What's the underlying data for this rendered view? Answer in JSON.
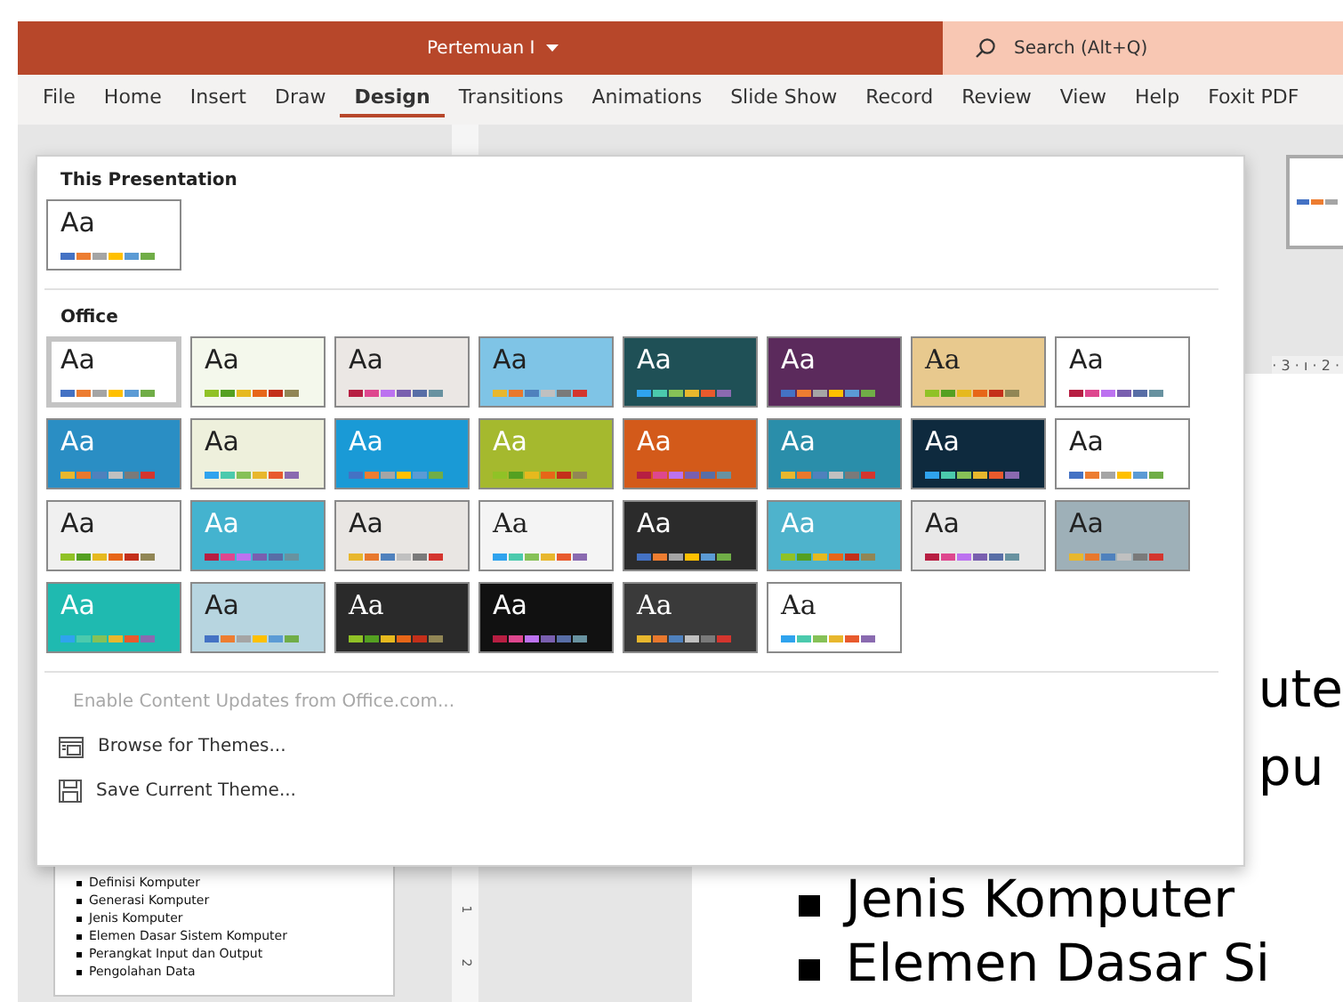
{
  "window": {
    "title": "Pertemuan I"
  },
  "search": {
    "placeholder": "Search (Alt+Q)"
  },
  "tabs": [
    {
      "label": "File",
      "selected": false
    },
    {
      "label": "Home",
      "selected": false
    },
    {
      "label": "Insert",
      "selected": false
    },
    {
      "label": "Draw",
      "selected": false
    },
    {
      "label": "Design",
      "selected": true
    },
    {
      "label": "Transitions",
      "selected": false
    },
    {
      "label": "Animations",
      "selected": false
    },
    {
      "label": "Slide Show",
      "selected": false
    },
    {
      "label": "Record",
      "selected": false
    },
    {
      "label": "Review",
      "selected": false
    },
    {
      "label": "View",
      "selected": false
    },
    {
      "label": "Help",
      "selected": false
    },
    {
      "label": "Foxit PDF",
      "selected": false
    }
  ],
  "ruler": {
    "horizontal": "· 3 · ı · 2 ·",
    "vertical": [
      "1",
      "2"
    ]
  },
  "themes_menu": {
    "sections": [
      {
        "title": "This Presentation",
        "themes": [
          {
            "label": "Aa",
            "kind": "sans",
            "selected": false,
            "color": "#ffffff"
          }
        ]
      },
      {
        "title": "Office",
        "themes": [
          {
            "label": "Aa",
            "kind": "sans",
            "selected": true,
            "color": "#ffffff"
          },
          {
            "label": "Aa",
            "kind": "sans",
            "selected": false,
            "color": "#f4f8ec"
          },
          {
            "label": "Aa",
            "kind": "sans",
            "selected": false,
            "color": "#ebe7e4"
          },
          {
            "label": "Aa",
            "kind": "sans",
            "selected": false,
            "color": "#7fc4e6"
          },
          {
            "label": "Aa",
            "kind": "sans",
            "selected": false,
            "color": "#1f5056"
          },
          {
            "label": "Aa",
            "kind": "sans",
            "selected": false,
            "color": "#5b2a5c"
          },
          {
            "label": "Aa",
            "kind": "serif",
            "selected": false,
            "color": "#e8c98e"
          },
          {
            "label": "Aa",
            "kind": "sans",
            "selected": false,
            "color": "#ffffff"
          },
          {
            "label": "Aa",
            "kind": "sans",
            "selected": false,
            "color": "#2a8ec4"
          },
          {
            "label": "Aa",
            "kind": "sans",
            "selected": false,
            "color": "#eef0dc"
          },
          {
            "label": "Aa",
            "kind": "sans",
            "selected": false,
            "color": "#1a9ad6"
          },
          {
            "label": "Aa",
            "kind": "sans",
            "selected": false,
            "color": "#a5b92e"
          },
          {
            "label": "Aa",
            "kind": "sans",
            "selected": false,
            "color": "#d35a1a"
          },
          {
            "label": "Aa",
            "kind": "sans",
            "selected": false,
            "color": "#2a8eaa"
          },
          {
            "label": "Aa",
            "kind": "sans",
            "selected": false,
            "color": "#0e2a3e"
          },
          {
            "label": "Aa",
            "kind": "sans",
            "selected": false,
            "color": "#ffffff"
          },
          {
            "label": "Aa",
            "kind": "sans",
            "selected": false,
            "color": "#f0f0f0"
          },
          {
            "label": "Aa",
            "kind": "sans",
            "selected": false,
            "color": "#44b3cf"
          },
          {
            "label": "Aa",
            "kind": "sans",
            "selected": false,
            "color": "#e9e6e3"
          },
          {
            "label": "Aa",
            "kind": "serif",
            "selected": false,
            "color": "#f4f4f4"
          },
          {
            "label": "Aa",
            "kind": "sans",
            "selected": false,
            "color": "#2b2b2b"
          },
          {
            "label": "Aa",
            "kind": "sans",
            "selected": false,
            "color": "#4eb3cc"
          },
          {
            "label": "Aa",
            "kind": "sans",
            "selected": false,
            "color": "#e8e8e8"
          },
          {
            "label": "Aa",
            "kind": "sans",
            "selected": false,
            "color": "#9eb0b8"
          },
          {
            "label": "Aa",
            "kind": "sans",
            "selected": false,
            "color": "#1fbab0"
          },
          {
            "label": "Aa",
            "kind": "sans",
            "selected": false,
            "color": "#b7d5e0"
          },
          {
            "label": "Aa",
            "kind": "serif",
            "selected": false,
            "color": "#2a2a2a"
          },
          {
            "label": "Aa",
            "kind": "sans",
            "selected": false,
            "color": "#111111"
          },
          {
            "label": "Aa",
            "kind": "serif",
            "selected": false,
            "color": "#3a3a3a"
          },
          {
            "label": "Aa",
            "kind": "serif",
            "selected": false,
            "color": "#ffffff"
          }
        ]
      }
    ],
    "actions": [
      {
        "label": "Enable Content Updates from Office.com...",
        "kind": "plain",
        "disabled": true
      },
      {
        "label": "Browse for Themes...",
        "kind": "browse",
        "disabled": false
      },
      {
        "label": "Save Current Theme...",
        "kind": "save",
        "disabled": false
      }
    ]
  },
  "thumbnail": {
    "bullets": [
      "Definisi Komputer",
      "Generasi Komputer",
      "Jenis Komputer",
      "Elemen Dasar Sistem Komputer",
      "Perangkat Input dan Output",
      "Pengolahan Data"
    ]
  },
  "slide": {
    "fragments": [
      "ute",
      "pu"
    ],
    "bullets": [
      "Jenis Komputer",
      "Elemen Dasar Si"
    ]
  }
}
